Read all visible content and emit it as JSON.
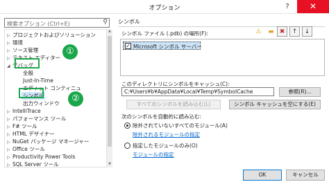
{
  "window": {
    "title": "オプション",
    "help_glyph": "?",
    "close_glyph": "✕"
  },
  "search": {
    "placeholder": "検索オプション (Ctrl+E)",
    "icon": "search-icon"
  },
  "tree": {
    "items": [
      {
        "label": "プロジェクトおよびソリューション",
        "arrow": "▷"
      },
      {
        "label": "環境",
        "arrow": "▷"
      },
      {
        "label": "ソース管理",
        "arrow": "▷"
      },
      {
        "label": "テキスト エディター",
        "arrow": "▷"
      },
      {
        "label": "デバッグ",
        "arrow": "◢"
      },
      {
        "label": "全般",
        "arrow": ""
      },
      {
        "label": "Just-In-Time",
        "arrow": ""
      },
      {
        "label": "エディット コンティニュ",
        "arrow": ""
      },
      {
        "label": "シンボル",
        "arrow": ""
      },
      {
        "label": "出力ウィンドウ",
        "arrow": ""
      },
      {
        "label": "IntelliTrace",
        "arrow": "▷"
      },
      {
        "label": "パフォーマンス ツール",
        "arrow": "▷"
      },
      {
        "label": "F# ツール",
        "arrow": "▷"
      },
      {
        "label": "HTML デザイナー",
        "arrow": "▷"
      },
      {
        "label": "NuGet パッケージ マネージャー",
        "arrow": "▷"
      },
      {
        "label": "Office ツール",
        "arrow": "▷"
      },
      {
        "label": "Productivity Power Tools",
        "arrow": "▷"
      },
      {
        "label": "SQL Server ツール",
        "arrow": "▷"
      }
    ]
  },
  "callouts": {
    "one": "①",
    "two": "②",
    "color": "#1aa64a"
  },
  "pane": {
    "header": "シンボル",
    "locations_label": "シンボル ファイル (.pdb) の場所(F):",
    "toolbar": {
      "warn_glyph": "⚠",
      "folder_glyph": "▬",
      "delete_glyph": "✖",
      "up_glyph": "↑",
      "down_glyph": "↓"
    },
    "locations": [
      {
        "label": "Microsoft シンボル サーバー",
        "checked": true,
        "check_glyph": "✓"
      }
    ],
    "cache_label": "このディレクトリにシンボルをキャッシュ(C):",
    "cache_value": "C:¥Users¥b¥AppData¥Local¥Temp¥SymbolCache",
    "browse_label": "参照(R)...",
    "load_all_label": "すべてのシンボルを読み込む(L)",
    "empty_cache_label": "シンボル キャッシュを空にする(E)",
    "auto_load_label": "次のシンボルを自動的に読み込む:",
    "option_all_label": "除外されていないすべてのモジュール(A)",
    "option_all_link": "除外されるモジュールの指定",
    "option_specific_label": "指定したモジュールのみ(O)",
    "option_specific_link": "モジュールの指定",
    "selected_option": "all"
  },
  "footer": {
    "ok_label": "OK",
    "cancel_label": "キャンセル"
  }
}
